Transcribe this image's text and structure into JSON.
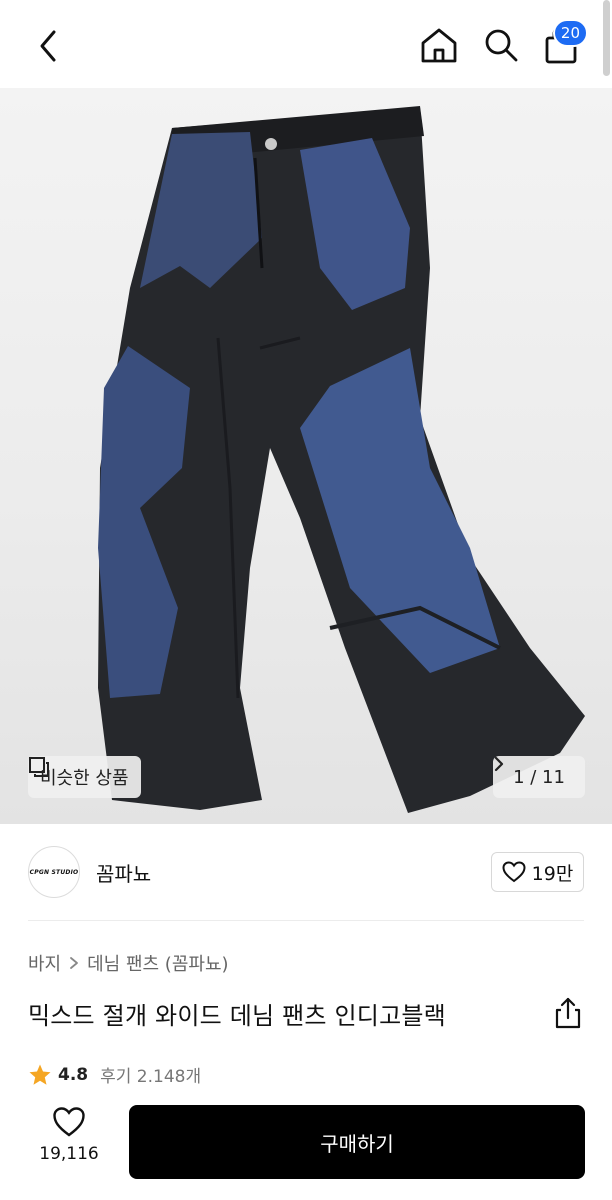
{
  "header": {
    "back_icon": "chevron-left-icon",
    "home_icon": "home-icon",
    "search_icon": "search-icon",
    "cart_icon": "shopping-bag-icon",
    "cart_count": "20",
    "badge_color": "#1d6bf3"
  },
  "gallery": {
    "similar_label": "비슷한 상품",
    "similar_icon": "overlap-squares-icon",
    "page_indicator": "1 / 11",
    "next_icon": "chevron-right-icon"
  },
  "brand": {
    "logo_text": "CPGN STUDIO",
    "name": "꼼파뇨",
    "likes": "19만",
    "like_icon": "heart-outline-icon"
  },
  "breadcrumb": {
    "category": "바지",
    "separator_icon": "chevron-right-icon",
    "subcategory": "데님 팬츠 (꼼파뇨)"
  },
  "product": {
    "title": "믹스드 절개 와이드 데님 팬츠 인디고블랙",
    "share_icon": "share-icon",
    "rating": "4.8",
    "rating_icon": "star-icon",
    "rating_color": "#f5a623",
    "reviews": "후기 2.148개"
  },
  "bottom_bar": {
    "like_icon": "heart-outline-icon",
    "like_count": "19,116",
    "buy_label": "구매하기",
    "buy_color": "#000000"
  }
}
